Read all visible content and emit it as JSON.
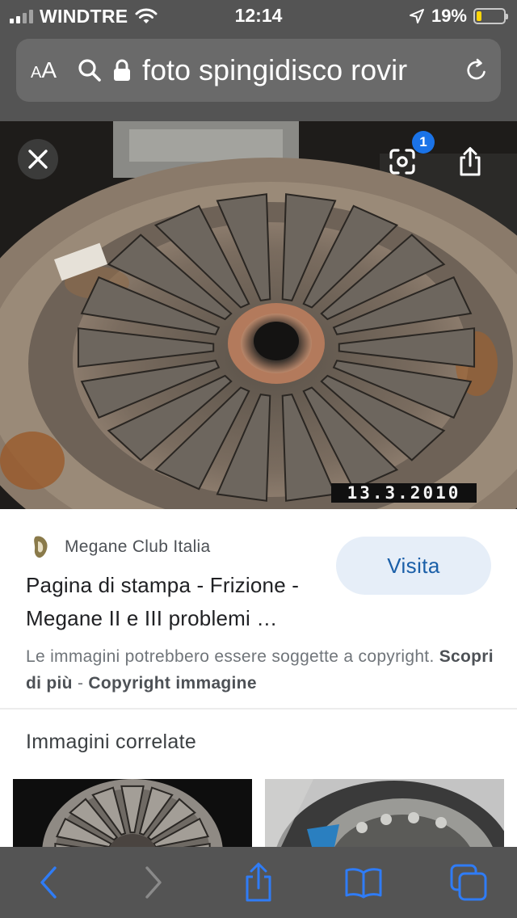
{
  "status_bar": {
    "carrier": "WINDTRE",
    "time": "12:14",
    "battery_percent": "19%",
    "battery_level": 0.19,
    "signal_bars": 2,
    "battery_color": "#ffd60a",
    "icons": [
      "signal-icon",
      "wifi-icon",
      "location-arrow-icon",
      "battery-icon"
    ]
  },
  "url_bar": {
    "text_size_label_small": "A",
    "text_size_label_large": "A",
    "url_text": "foto spingidisco rovir",
    "icons": [
      "search-icon",
      "lock-icon",
      "reload-icon"
    ]
  },
  "viewer": {
    "date_stamp": "13.3.2010",
    "lens_badge_count": "1",
    "icons": [
      "close-icon",
      "google-lens-icon",
      "share-icon"
    ]
  },
  "result": {
    "site_name": "Megane Club Italia",
    "title": "Pagina di stampa - Frizione - Megane II e III problemi …",
    "visit_label": "Visita",
    "copyright_text": "Le immagini potrebbero essere soggette a copyright.",
    "learn_more_label": "Scopri di più",
    "separator": "-",
    "image_copyright_label": "Copyright immagine",
    "accent_color": "#1a5fa8"
  },
  "related": {
    "heading": "Immagini correlate"
  },
  "toolbar": {
    "icons": [
      "back-icon",
      "forward-icon",
      "share-icon",
      "bookmarks-icon",
      "tabs-icon"
    ],
    "accent_color": "#2f7cf6"
  }
}
